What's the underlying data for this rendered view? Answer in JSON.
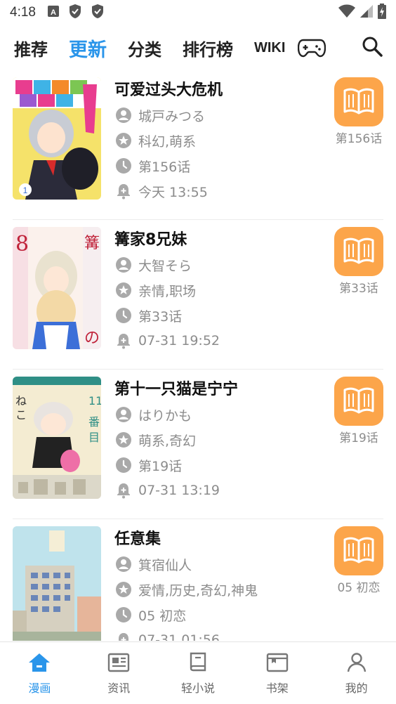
{
  "status_bar": {
    "time": "4:18"
  },
  "top_nav": {
    "tabs": [
      {
        "label": "推荐",
        "active": false
      },
      {
        "label": "更新",
        "active": true
      },
      {
        "label": "分类",
        "active": false
      },
      {
        "label": "排行榜",
        "active": false
      },
      {
        "label": "WIKI",
        "active": false
      }
    ],
    "icons": [
      "gamepad-icon",
      "search-icon"
    ]
  },
  "items": [
    {
      "title": "可爱过头大危机",
      "author": "城戸みつる",
      "tags": "科幻,萌系",
      "latest": "第156话",
      "updated": "今天 13:55",
      "chapter_label": "第156话"
    },
    {
      "title": "篝家8兄妹",
      "author": "大智そら",
      "tags": "亲情,职场",
      "latest": "第33话",
      "updated": "07-31 19:52",
      "chapter_label": "第33话"
    },
    {
      "title": "第十一只猫是宁宁",
      "author": "はりかも",
      "tags": "萌系,奇幻",
      "latest": "第19话",
      "updated": "07-31 13:19",
      "chapter_label": "第19话"
    },
    {
      "title": "任意集",
      "author": "箕宿仙人",
      "tags": "爱情,历史,奇幻,神鬼",
      "latest": "05 初恋",
      "updated": "07-31 01:56",
      "chapter_label": "05 初恋"
    }
  ],
  "bottom_nav": [
    {
      "label": "漫画",
      "active": true
    },
    {
      "label": "资讯",
      "active": false
    },
    {
      "label": "轻小说",
      "active": false
    },
    {
      "label": "书架",
      "active": false
    },
    {
      "label": "我的",
      "active": false
    }
  ],
  "colors": {
    "accent": "#2a95ea",
    "read_button": "#fca54a",
    "meta_text": "#8c8c8c"
  }
}
